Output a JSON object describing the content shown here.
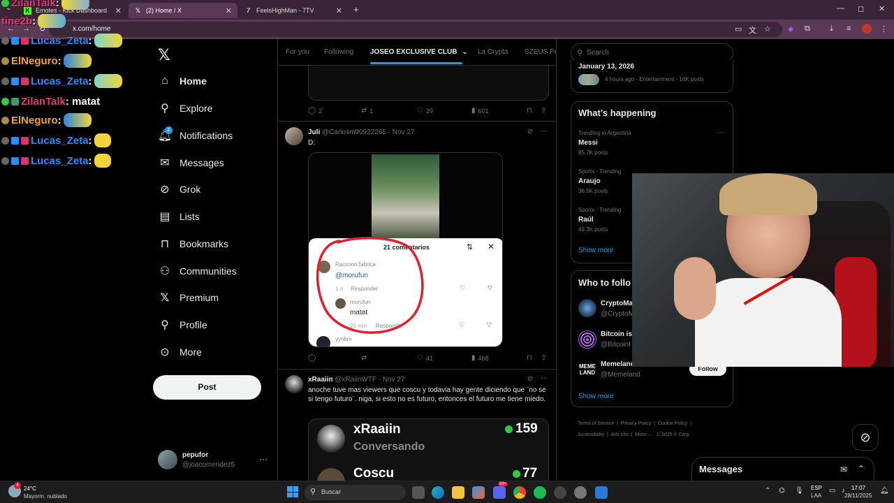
{
  "browser": {
    "tabs": [
      {
        "label": "Emotes - Kick Dashboard",
        "favicon": "K",
        "active": false
      },
      {
        "label": "(2) Home / X",
        "favicon": "X",
        "active": true
      },
      {
        "label": "FeelsHighMan - 7TV",
        "favicon": "7",
        "active": false
      }
    ],
    "new_tab": "+",
    "url": "x.com/home",
    "window_controls": {
      "minimize": "—",
      "maximize": "◻",
      "close": "✕"
    }
  },
  "chat": [
    {
      "user": "ZilanTalk",
      "message": "",
      "color": "#e03a7a"
    },
    {
      "user": "tine2b",
      "message": "",
      "color": "#e03a7a"
    },
    {
      "user": "Lucas_Zeta",
      "message": "",
      "color": "#2e8bff"
    },
    {
      "user": "ElNeguro",
      "message": "",
      "color": "#f5a623"
    },
    {
      "user": "Lucas_Zeta",
      "message": "",
      "color": "#2e8bff"
    },
    {
      "user": "ZilanTalk",
      "message": "matat",
      "color": "#e03a7a"
    },
    {
      "user": "ElNeguro",
      "message": "",
      "color": "#f5a623"
    },
    {
      "user": "Lucas_Zeta",
      "message": "",
      "color": "#2e8bff"
    },
    {
      "user": "Lucas_Zeta",
      "message": "",
      "color": "#2e8bff"
    }
  ],
  "nav": {
    "items": [
      {
        "label": "Home",
        "icon": "home-icon"
      },
      {
        "label": "Explore",
        "icon": "search-icon"
      },
      {
        "label": "Notifications",
        "icon": "bell-icon",
        "badge": "2"
      },
      {
        "label": "Messages",
        "icon": "envelope-icon"
      },
      {
        "label": "Grok",
        "icon": "grok-icon"
      },
      {
        "label": "Lists",
        "icon": "list-icon"
      },
      {
        "label": "Bookmarks",
        "icon": "bookmark-icon"
      },
      {
        "label": "Communities",
        "icon": "people-icon"
      },
      {
        "label": "Premium",
        "icon": "x-logo-icon"
      },
      {
        "label": "Profile",
        "icon": "person-icon"
      },
      {
        "label": "More",
        "icon": "more-circle-icon"
      }
    ],
    "post_label": "Post",
    "account": {
      "name": "pepufor",
      "handle": "@joacomendez5"
    }
  },
  "feed": {
    "tabs": [
      "For you",
      "Following",
      "JOSEO EXCLUSIVE CLUB",
      "La Crypta",
      "SZEUS Pe"
    ],
    "tweet0_actions": {
      "replies": "2",
      "reposts": "1",
      "likes": "29",
      "views": "601"
    },
    "tweet1": {
      "name": "Juli",
      "handle": "@Carlosm90922265",
      "date": "Nov 27",
      "text": "D:",
      "embed": {
        "header": "21 comentarios",
        "c1_user": "Raccoon.fabrica",
        "c1_text": "@morufun",
        "c1_time": "1 d",
        "c1_reply": "Responder",
        "c2_user": "morufun",
        "c2_text": "matat",
        "c2_time": "25 min",
        "c2_reply": "Responder",
        "c3_user": "yynbm"
      },
      "actions": {
        "replies": "",
        "reposts": "",
        "likes": "41",
        "views": "468"
      }
    },
    "tweet2": {
      "name": "xRaaiin",
      "handle": "@xRaiinWTF",
      "date": "Nov 27",
      "text": "anoche tuve mas viewers que coscu y todavia hay gente diciendo que ¨no se si tengo futuro¨. niga, si esto no es futuro, entonces el futuro me tiene miedo.",
      "card": {
        "row1_name": "xRaaiin",
        "row1_status": "Conversando",
        "row1_count": "159",
        "row2_name": "Coscu",
        "row2_count": "77"
      }
    }
  },
  "right": {
    "search_placeholder": "Search",
    "news": {
      "date": "January 13, 2026",
      "meta": "4 hours ago · Entertainment · 16K posts"
    },
    "happening": {
      "title": "What’s happening",
      "trends": [
        {
          "context": "Trending in Argentina",
          "name": "Messi",
          "posts": "85.7K posts"
        },
        {
          "context": "Sports · Trending",
          "name": "Araujo",
          "posts": "36.5K posts"
        },
        {
          "context": "Sports · Trending",
          "name": "Raúl",
          "posts": "49.3K posts"
        }
      ],
      "show_more": "Show more"
    },
    "follow": {
      "title": "Who to follo",
      "accounts": [
        {
          "name": "CryptoMa",
          "handle": "@CryptoM"
        },
        {
          "name": "Bitcoin is",
          "handle": "@BitcoinI"
        },
        {
          "name": "Memelanc",
          "handle": "@Memeland"
        }
      ],
      "follow_label": "Follow",
      "show_more": "Show more",
      "memeland_logo": "MEME LAND"
    },
    "footer": [
      "Terms of Service",
      "Privacy Policy",
      "Cookie Policy",
      "Accessibility",
      "Ads info",
      "More ···",
      "© 2025 X Corp."
    ]
  },
  "messages_drawer": {
    "label": "Messages"
  },
  "taskbar": {
    "weather_temp": "24°C",
    "weather_desc": "Mayorm. nublado",
    "search_placeholder": "Buscar",
    "lang_top": "ESP",
    "lang_bottom": "LAA",
    "time": "17:07",
    "date": "28/11/2025",
    "notif_badge": "4",
    "discord_badge": "99+"
  },
  "colors": {
    "accent": "#1d9bf0",
    "annotation": "#e0202e",
    "online": "#2ecc40"
  }
}
